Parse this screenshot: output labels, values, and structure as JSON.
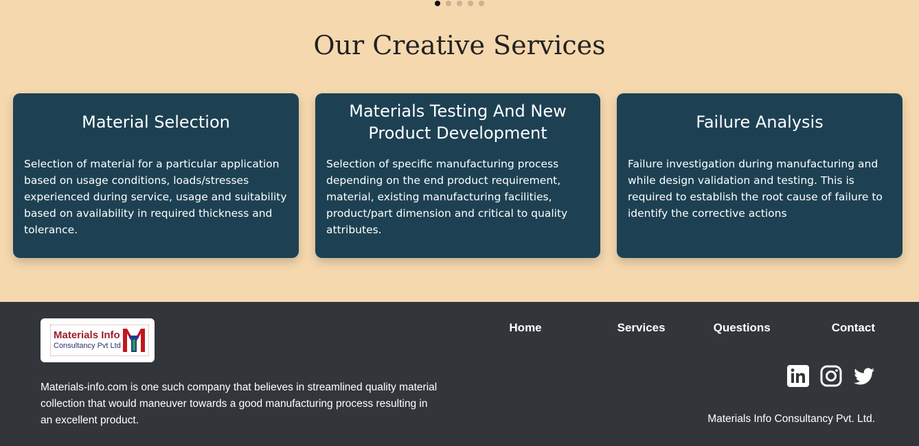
{
  "carousel": {
    "dots": 5,
    "active_index": 0
  },
  "services": {
    "title": "Our Creative Services",
    "cards": [
      {
        "title": "Material Selection",
        "body": "Selection of material for a particular application based on usage conditions, loads/stresses experienced during service, usage and suitability based on availability in required thickness and tolerance."
      },
      {
        "title": "Materials Testing And New Product Development",
        "body": "Selection of specific manufacturing process depending on the end product requirement, material, existing manufacturing facilities, product/part dimension and critical to quality attributes."
      },
      {
        "title": "Failure Analysis",
        "body": "Failure investigation during manufacturing and while design validation and testing. This is required to establish the root cause of failure to identify the corrective actions"
      }
    ]
  },
  "footer": {
    "logo": {
      "line1": "Materials Info",
      "line2": "Consultancy Pvt Ltd"
    },
    "about": "Materials-info.com is one such company that believes in streamlined quality material collection that would maneuver towards a good manufacturing process resulting in an excellent product.",
    "nav": {
      "home": "Home",
      "services": "Services",
      "questions": "Questions",
      "contact": "Contact"
    },
    "social_icons": [
      "linkedin-icon",
      "instagram-icon",
      "twitter-icon"
    ],
    "copyright": "Materials Info Consultancy Pvt. Ltd."
  },
  "colors": {
    "page_bg": "#f5d8ae",
    "card_bg": "#1d4153",
    "footer_bg": "#32363b",
    "logo_red": "#a01c2a",
    "logo_blue": "#2a2f6b"
  }
}
